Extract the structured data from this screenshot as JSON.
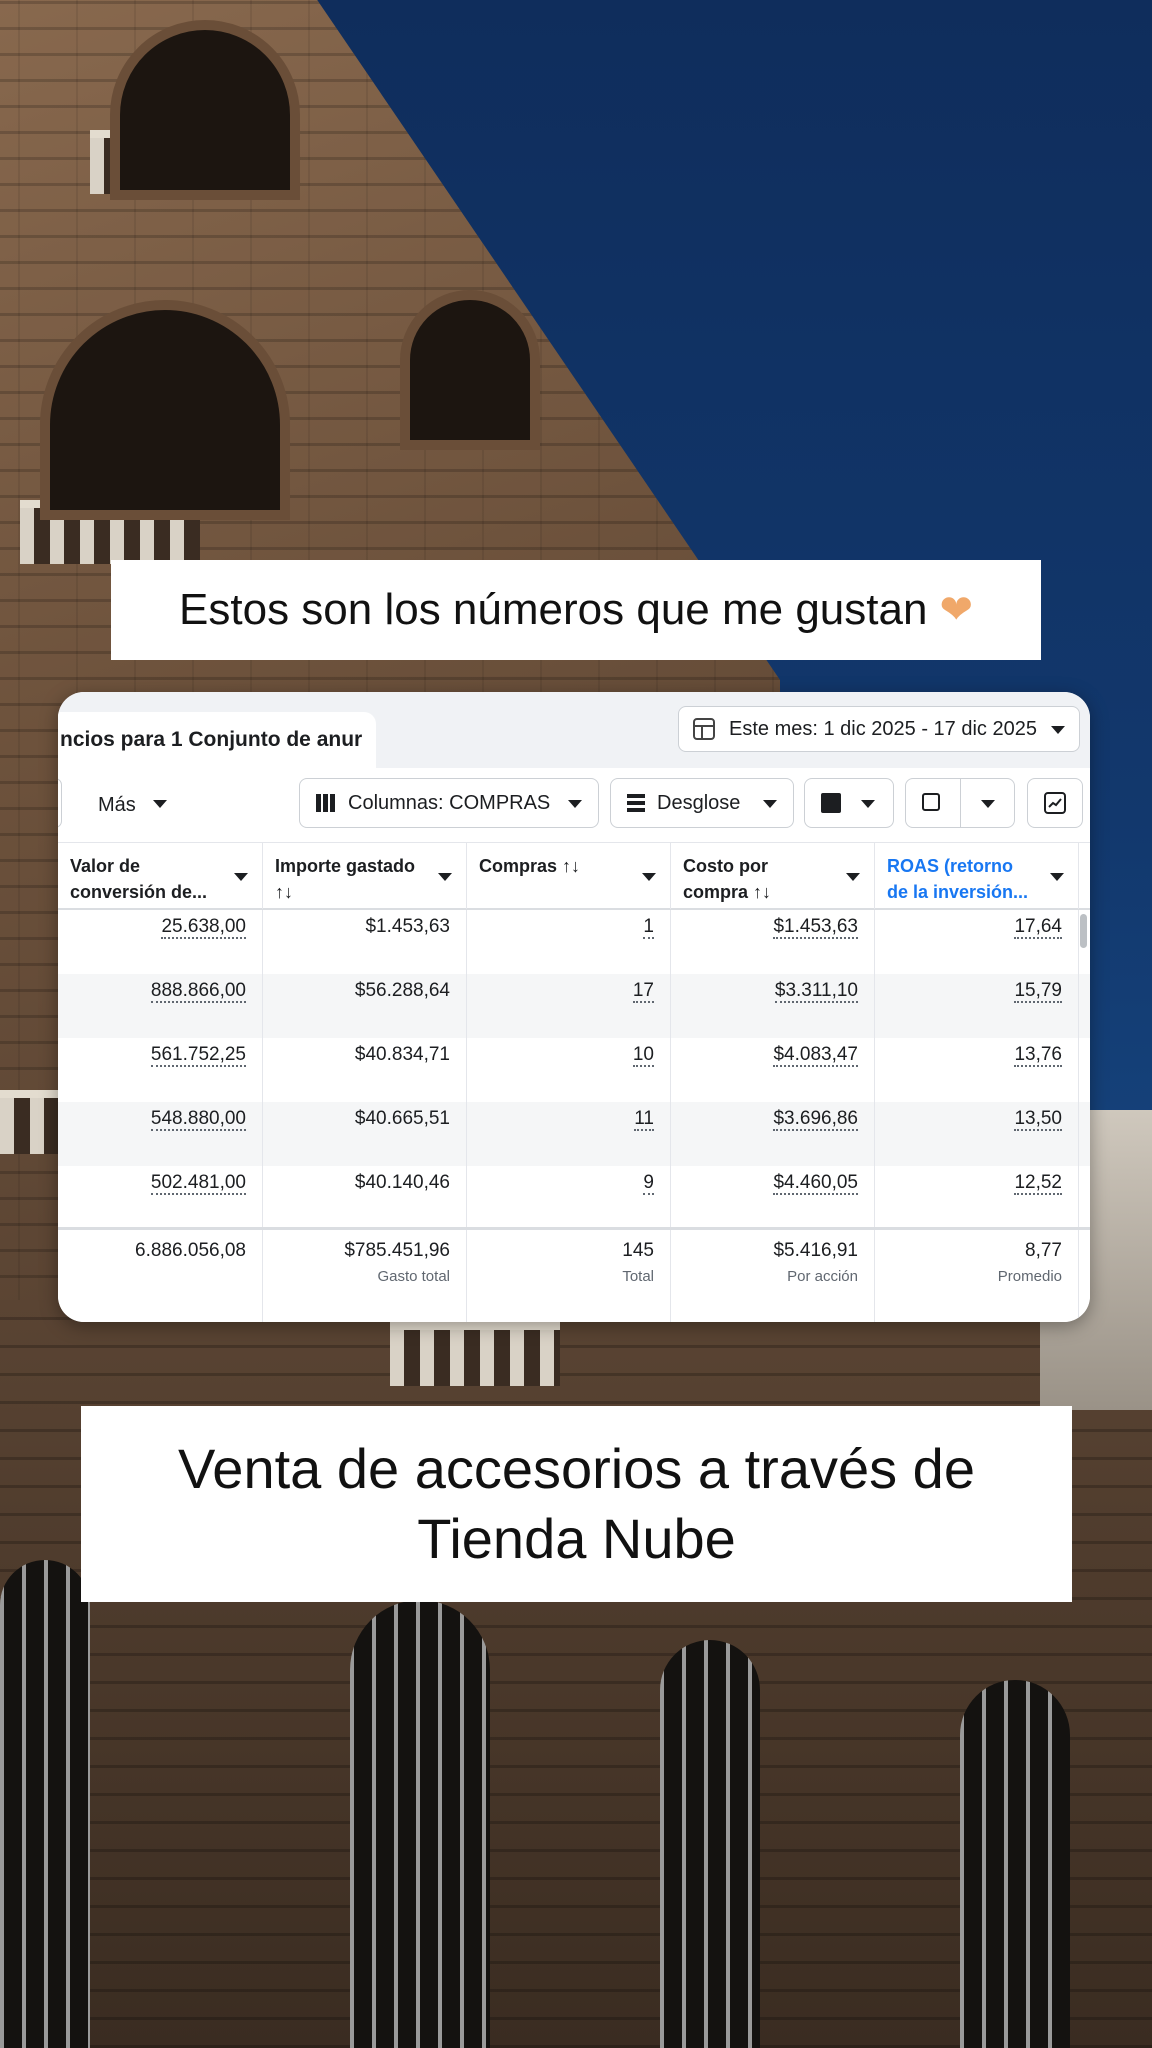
{
  "captions": {
    "top": "Estos son los números que me gustan",
    "bottom_line1": "Venta de accesorios a través de",
    "bottom_line2": "Tienda Nube"
  },
  "panel": {
    "tab_label": "ncios para 1 Conjunto de anur",
    "date_range": "Este mes: 1 dic 2025 - 17 dic 2025",
    "more_label": "Más",
    "columns_label": "Columnas: COMPRAS",
    "breakdown_label": "Desglose"
  },
  "table": {
    "headers": [
      {
        "line1": "Valor de",
        "line2": "conversión de..."
      },
      {
        "line1": "Importe gastado",
        "line2": "↑↓"
      },
      {
        "line1": "Compras ↑↓",
        "line2": ""
      },
      {
        "line1": "Costo por",
        "line2": "compra ↑↓"
      },
      {
        "line1": "ROAS (retorno",
        "line2": "de la inversión..."
      }
    ],
    "rows": [
      [
        "25.638,00",
        "$1.453,63",
        "1",
        "$1.453,63",
        "17,64"
      ],
      [
        "888.866,00",
        "$56.288,64",
        "17",
        "$3.311,10",
        "15,79"
      ],
      [
        "561.752,25",
        "$40.834,71",
        "10",
        "$4.083,47",
        "13,76"
      ],
      [
        "548.880,00",
        "$40.665,51",
        "11",
        "$3.696,86",
        "13,50"
      ],
      [
        "502.481,00",
        "$40.140,46",
        "9",
        "$4.460,05",
        "12,52"
      ]
    ],
    "totals": [
      {
        "value": "6.886.056,08",
        "sub": ""
      },
      {
        "value": "$785.451,96",
        "sub": "Gasto total"
      },
      {
        "value": "145",
        "sub": "Total"
      },
      {
        "value": "$5.416,91",
        "sub": "Por acción"
      },
      {
        "value": "8,77",
        "sub": "Promedio"
      }
    ]
  },
  "colors": {
    "accent": "#1877f2",
    "text": "#1c1e21",
    "muted": "#606770"
  },
  "icons": [
    "calendar-icon",
    "columns-icon",
    "breakdown-icon",
    "reports-icon",
    "export-icon",
    "chart-icon",
    "heart-hands-emoji"
  ]
}
